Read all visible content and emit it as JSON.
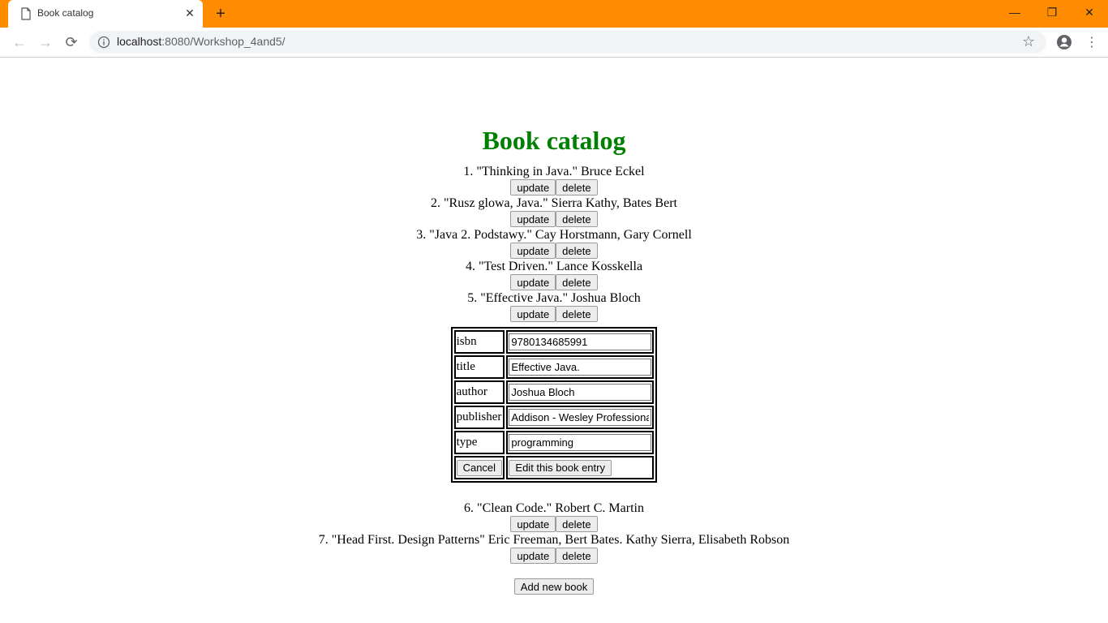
{
  "browser": {
    "tab_title": "Book catalog",
    "new_tab_symbol": "+",
    "close_symbol": "✕",
    "url_host": "localhost",
    "url_rest": ":8080/Workshop_4and5/",
    "window_controls": {
      "minimize": "—",
      "restore": "❐",
      "close": "✕"
    },
    "nav": {
      "back": "←",
      "forward": "→",
      "reload": "⟳"
    }
  },
  "page": {
    "heading": "Book catalog",
    "update_label": "update",
    "delete_label": "delete",
    "books": [
      {
        "text": "1. \"Thinking in Java.\" Bruce Eckel"
      },
      {
        "text": "2. \"Rusz glowa, Java.\" Sierra Kathy, Bates Bert"
      },
      {
        "text": "3. \"Java 2. Podstawy.\" Cay Horstmann, Gary Cornell"
      },
      {
        "text": "4. \"Test Driven.\" Lance Kosskella"
      },
      {
        "text": "5. \"Effective Java.\" Joshua Bloch"
      },
      {
        "text": "6. \"Clean Code.\" Robert C. Martin"
      },
      {
        "text": "7. \"Head First. Design Patterns\" Eric Freeman, Bert Bates. Kathy Sierra, Elisabeth Robson"
      }
    ],
    "edit_form": {
      "fields": [
        {
          "label": "isbn",
          "value": "9780134685991"
        },
        {
          "label": "title",
          "value": "Effective Java."
        },
        {
          "label": "author",
          "value": "Joshua Bloch"
        },
        {
          "label": "publisher",
          "value": "Addison - Wesley Professional"
        },
        {
          "label": "type",
          "value": "programming"
        }
      ],
      "cancel_label": "Cancel",
      "submit_label": "Edit this book entry"
    },
    "add_label": "Add new book"
  }
}
